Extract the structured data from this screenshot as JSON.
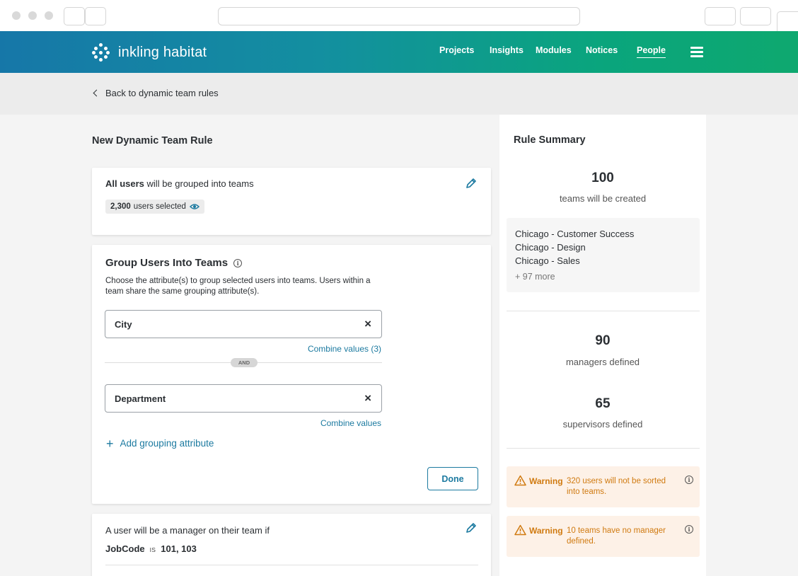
{
  "app": {
    "brand": "inkling habitat",
    "nav": [
      {
        "label": "Projects",
        "active": false
      },
      {
        "label": "Insights",
        "active": false
      },
      {
        "label": "Modules",
        "active": false
      },
      {
        "label": "Notices",
        "active": false
      },
      {
        "label": "People",
        "active": true
      }
    ],
    "accent": "#1c7aa0",
    "warning_color": "#d07a10"
  },
  "breadcrumb": {
    "back_label": "Back to dynamic team rules"
  },
  "page_title": "New Dynamic Team Rule",
  "users_card": {
    "lead_bold": "All users",
    "lead_rest": " will be grouped into teams",
    "selected_count": "2,300",
    "selected_label": "users selected"
  },
  "group_card": {
    "title": "Group Users Into Teams",
    "description": "Choose the attribute(s) to group selected users into teams. Users within a team share the same grouping attribute(s).",
    "attributes": [
      {
        "label": "City",
        "combine_label": "Combine values (3)"
      },
      {
        "label": "Department",
        "combine_label": "Combine values"
      }
    ],
    "and_label": "AND",
    "add_label": "Add grouping attribute",
    "done_label": "Done"
  },
  "manager_card": {
    "text": "A user will be a manager on their team if",
    "field": "JobCode",
    "operator": "IS",
    "values": "101, 103"
  },
  "summary": {
    "title": "Rule Summary",
    "teams_count": "100",
    "teams_label": "teams will be created",
    "team_names": [
      "Chicago - Customer Success",
      "Chicago - Design",
      "Chicago - Sales"
    ],
    "more_label": "+ 97 more",
    "managers_count": "90",
    "managers_label": "managers defined",
    "supervisors_count": "65",
    "supervisors_label": "supervisors defined",
    "warnings": [
      {
        "label": "Warning",
        "message": "320 users will not be sorted into teams."
      },
      {
        "label": "Warning",
        "message": "10 teams have no manager defined."
      }
    ]
  }
}
